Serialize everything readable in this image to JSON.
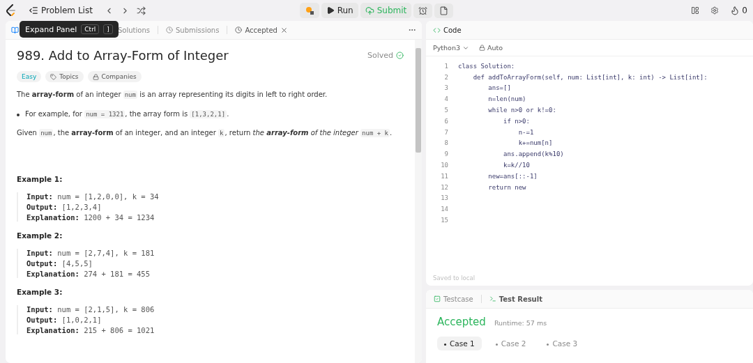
{
  "top_bar": {
    "problem_list": "Problem List",
    "run": "Run",
    "submit": "Submit",
    "streak": "0"
  },
  "tooltip": {
    "text": "Expand Panel",
    "keys": [
      "Ctrl",
      "]"
    ]
  },
  "tabs": [
    {
      "label": "Solutions",
      "selected": false,
      "closable": false
    },
    {
      "label": "Submissions",
      "selected": false,
      "closable": false
    },
    {
      "label": "Accepted",
      "selected": true,
      "closable": true
    }
  ],
  "problem": {
    "title": "989. Add to Array-Form of Integer",
    "status": "Solved",
    "difficulty": "Easy",
    "tags": [
      {
        "kind": "tag",
        "label": "Topics"
      },
      {
        "kind": "lock",
        "label": "Companies"
      }
    ],
    "paragraphs": [
      {
        "kind": "para",
        "parts": [
          {
            "kind": "text",
            "text": "The **array-form** of an integer "
          },
          {
            "kind": "code",
            "text": "num"
          },
          {
            "kind": "text",
            "text": " is an array representing its digits in left to right order."
          }
        ]
      },
      {
        "kind": "bullet",
        "parts": [
          {
            "kind": "text",
            "text": "For example, for "
          },
          {
            "kind": "code",
            "text": "num = 1321"
          },
          {
            "kind": "text",
            "text": ", the array form is "
          },
          {
            "kind": "code",
            "text": "[1,3,2,1]"
          },
          {
            "kind": "text",
            "text": "."
          }
        ]
      },
      {
        "kind": "para",
        "parts": [
          {
            "kind": "text",
            "text": "Given "
          },
          {
            "kind": "code",
            "text": "num"
          },
          {
            "kind": "text",
            "text": ", the **array-form** of an integer, and an integer "
          },
          {
            "kind": "code",
            "text": "k"
          },
          {
            "kind": "text",
            "text": ", return "
          },
          {
            "kind": "em",
            "text": "the **array-form** of the integer "
          },
          {
            "kind": "code",
            "text": "num + k"
          },
          {
            "kind": "text",
            "text": "."
          }
        ]
      }
    ],
    "examples": [
      {
        "title": "Example 1:",
        "lines": [
          {
            "label": "Input:",
            "value": "num = [1,2,0,0], k = 34"
          },
          {
            "label": "Output:",
            "value": "[1,2,3,4]"
          },
          {
            "label": "Explanation:",
            "value": "1200 + 34 = 1234"
          }
        ]
      },
      {
        "title": "Example 2:",
        "lines": [
          {
            "label": "Input:",
            "value": "num = [2,7,4], k = 181"
          },
          {
            "label": "Output:",
            "value": "[4,5,5]"
          },
          {
            "label": "Explanation:",
            "value": "274 + 181 = 455"
          }
        ]
      },
      {
        "title": "Example 3:",
        "lines": [
          {
            "label": "Input:",
            "value": "num = [2,1,5], k = 806"
          },
          {
            "label": "Output:",
            "value": "[1,0,2,1]"
          },
          {
            "label": "Explanation:",
            "value": "215 + 806 = 1021"
          }
        ]
      }
    ]
  },
  "editor": {
    "title": "Code",
    "language": "Python3",
    "mode": "Auto",
    "saved": "Saved to local",
    "lines": [
      {
        "number": "1",
        "text": "class Solution:"
      },
      {
        "number": "2",
        "text": "    def addToArrayForm(self, num: List[int], k: int) -> List[int]:"
      },
      {
        "number": "3",
        "text": "        ans=[]"
      },
      {
        "number": "4",
        "text": "        n=len(num)"
      },
      {
        "number": "5",
        "text": "        while n>0 or k!=0:"
      },
      {
        "number": "6",
        "text": "            if n>0:"
      },
      {
        "number": "7",
        "text": "                n-=1"
      },
      {
        "number": "8",
        "text": "                k+=num[n]"
      },
      {
        "number": "9",
        "text": "            ans.append(k%10)"
      },
      {
        "number": "10",
        "text": "            k=k//10"
      },
      {
        "number": "11",
        "text": "        new=ans[::-1]"
      },
      {
        "number": "12",
        "text": "        return new"
      },
      {
        "number": "13"
      },
      {
        "number": "14"
      },
      {
        "number": "15"
      }
    ]
  },
  "result": {
    "tabs": [
      {
        "label": "Testcase",
        "selected": false
      },
      {
        "label": "Test Result",
        "selected": true
      }
    ],
    "verdict": "Accepted",
    "runtime": "Runtime: 57 ms",
    "cases": [
      {
        "label": "Case 1",
        "selected": true
      },
      {
        "label": "Case 2",
        "selected": false
      },
      {
        "label": "Case 3",
        "selected": false
      }
    ]
  }
}
